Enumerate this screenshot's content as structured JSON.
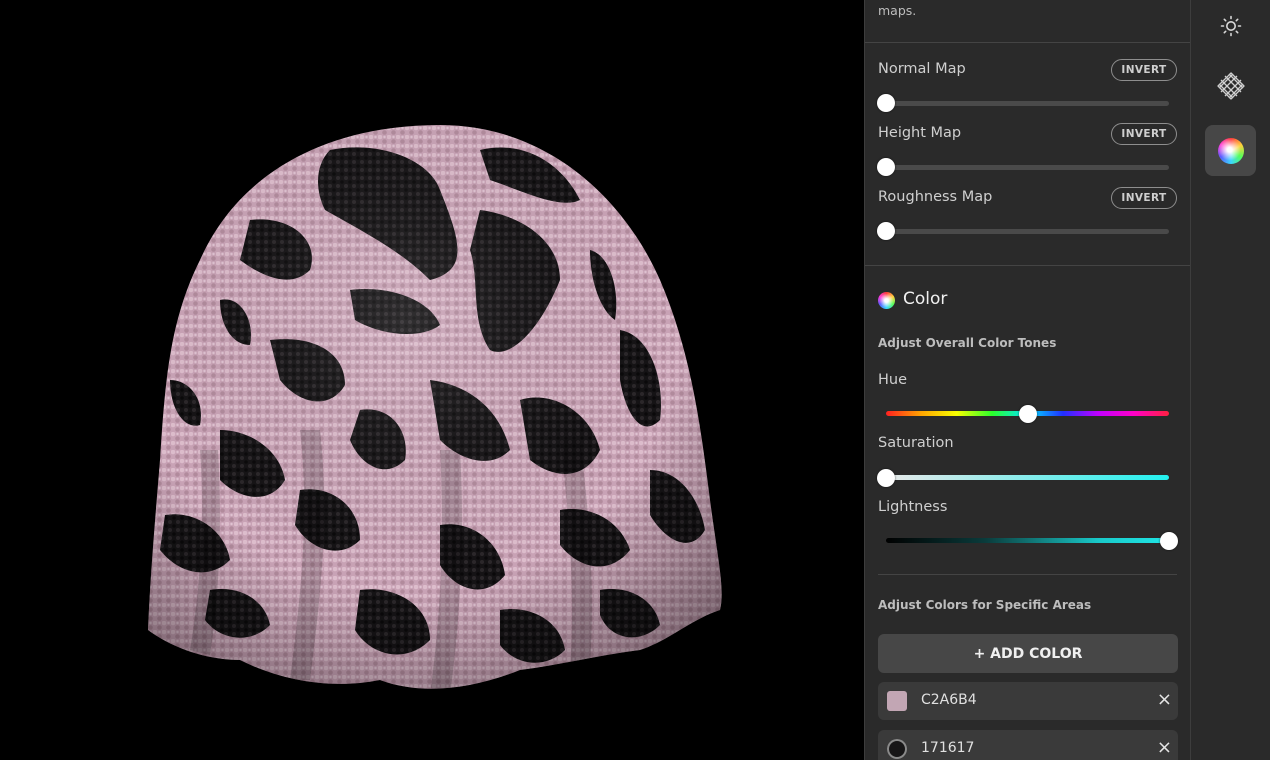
{
  "panel": {
    "top_text": "maps.",
    "maps": [
      {
        "label": "Normal Map",
        "invert_label": "INVERT",
        "value": 0
      },
      {
        "label": "Height Map",
        "invert_label": "INVERT",
        "value": 0
      },
      {
        "label": "Roughness Map",
        "invert_label": "INVERT",
        "value": 0
      }
    ],
    "color": {
      "title": "Color",
      "overall_heading": "Adjust Overall Color Tones",
      "hue": {
        "label": "Hue",
        "value": 0.5
      },
      "saturation": {
        "label": "Saturation",
        "value": 0
      },
      "lightness": {
        "label": "Lightness",
        "value": 1
      },
      "specific_heading": "Adjust Colors for Specific Areas",
      "add_button": "+ ADD COLOR",
      "colors": [
        {
          "hex": "C2A6B4",
          "swatch": "#c2a6b4"
        },
        {
          "hex": "171617",
          "swatch": "#171617"
        }
      ],
      "remove_icon": "×"
    }
  },
  "toolbar": {
    "tools": [
      {
        "icon": "sun-icon",
        "active": false
      },
      {
        "icon": "fabric-pattern-icon",
        "active": false
      },
      {
        "icon": "color-wheel-icon",
        "active": true
      }
    ]
  },
  "viewport": {
    "fabric_color": "#c9a3b6",
    "spot_color": "#161416"
  }
}
